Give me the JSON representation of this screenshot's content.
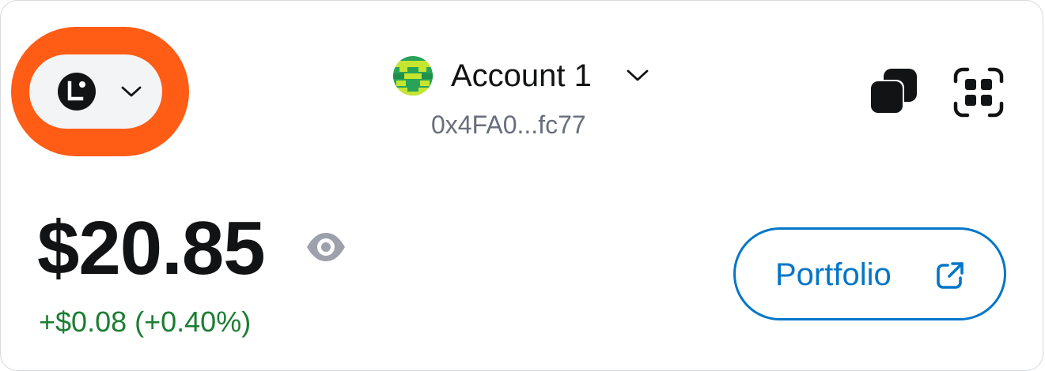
{
  "header": {
    "network_picker": {
      "icon": "linea-network-icon",
      "chevron_icon": "chevron-down-icon",
      "highlight_color": "#ff5c16"
    },
    "account": {
      "name": "Account 1",
      "address": "0x4FA0...fc77",
      "avatar_icon": "identicon-avatar",
      "chevron_icon": "chevron-down-icon"
    },
    "actions": {
      "copy_icon": "copy-icon",
      "scan_icon": "qr-scan-icon"
    }
  },
  "balance": {
    "amount": "$20.85",
    "visibility_icon": "eye-icon",
    "change": "+$0.08 (+0.40%)",
    "change_color": "#1c7e33"
  },
  "portfolio_button": {
    "label": "Portfolio",
    "icon": "external-link-icon",
    "color": "#0376c9"
  }
}
